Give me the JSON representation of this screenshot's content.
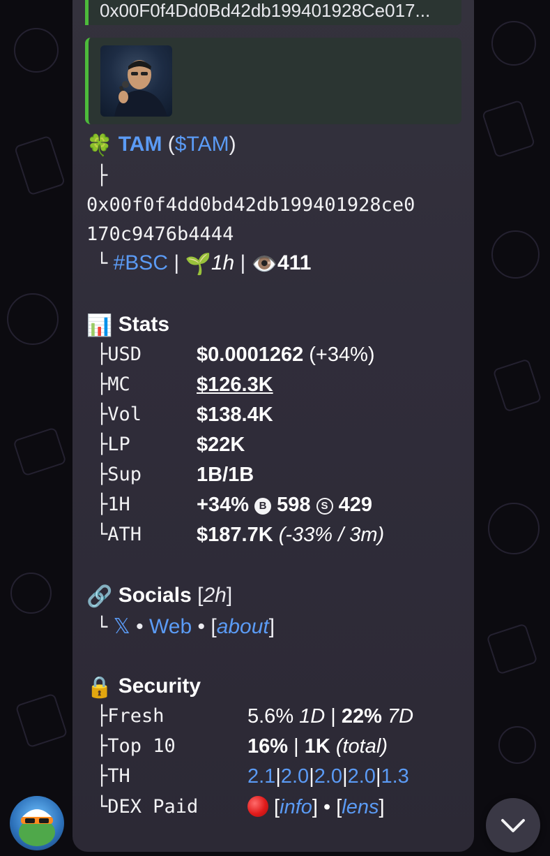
{
  "quote_top": {
    "address_text": "0x00F0f4Dd0Bd42db199401928Ce017..."
  },
  "token": {
    "emoji": "🍀",
    "name": "TAM",
    "ticker_open": " (",
    "ticker": "$TAM",
    "ticker_close": ")",
    "branch_char": "├",
    "contract_line1": "0x00f0f4dd0bd42db199401928ce0",
    "contract_line2": "170c9476b4444",
    "end_char": "└",
    "chain": "#BSC",
    "sep": "|",
    "age_emoji": "🌱",
    "age": "1h",
    "views_emoji": "👁️",
    "views": "411"
  },
  "stats": {
    "emoji": "📊",
    "title": "Stats",
    "rows": [
      {
        "prefix": "├",
        "key": "USD",
        "value": "$0.0001262",
        "extra": " (+34%)"
      },
      {
        "prefix": "├",
        "key": "MC",
        "value": "$126.3K",
        "extra": ""
      },
      {
        "prefix": "├",
        "key": "Vol",
        "value": "$138.4K",
        "extra": ""
      },
      {
        "prefix": "├",
        "key": "LP",
        "value": "$22K",
        "extra": ""
      },
      {
        "prefix": "├",
        "key": "Sup",
        "value": "1B/1B",
        "extra": ""
      },
      {
        "prefix": "├",
        "key": "1H",
        "value": "+34%",
        "buys_icon": "B",
        "buys": "598",
        "sells_icon": "S",
        "sells": "429"
      },
      {
        "prefix": "└",
        "key": "ATH",
        "value": "$187.7K",
        "extra": "(-33% / 3m)"
      }
    ]
  },
  "socials": {
    "emoji": "🔗",
    "title": "Socials",
    "age": "2h",
    "prefix": "└",
    "x_label": "𝕏",
    "dot": "•",
    "web_label": "Web",
    "about_label": "about"
  },
  "security": {
    "emoji": "🔒",
    "title": "Security",
    "fresh": {
      "prefix": "├",
      "key": "Fresh",
      "v1": "5.6%",
      "p1": "1D",
      "v2": "22%",
      "p2": "7D"
    },
    "top10": {
      "prefix": "├",
      "key": "Top 10",
      "v1": "16%",
      "v2": "1K",
      "p2": "(total)"
    },
    "th": {
      "prefix": "├",
      "key": "TH",
      "values": [
        "2.1",
        "2.0",
        "2.0",
        "2.0",
        "1.3"
      ]
    },
    "dex": {
      "prefix": "└",
      "key": "DEX Paid",
      "info_label": "info",
      "lens_label": "lens"
    }
  }
}
